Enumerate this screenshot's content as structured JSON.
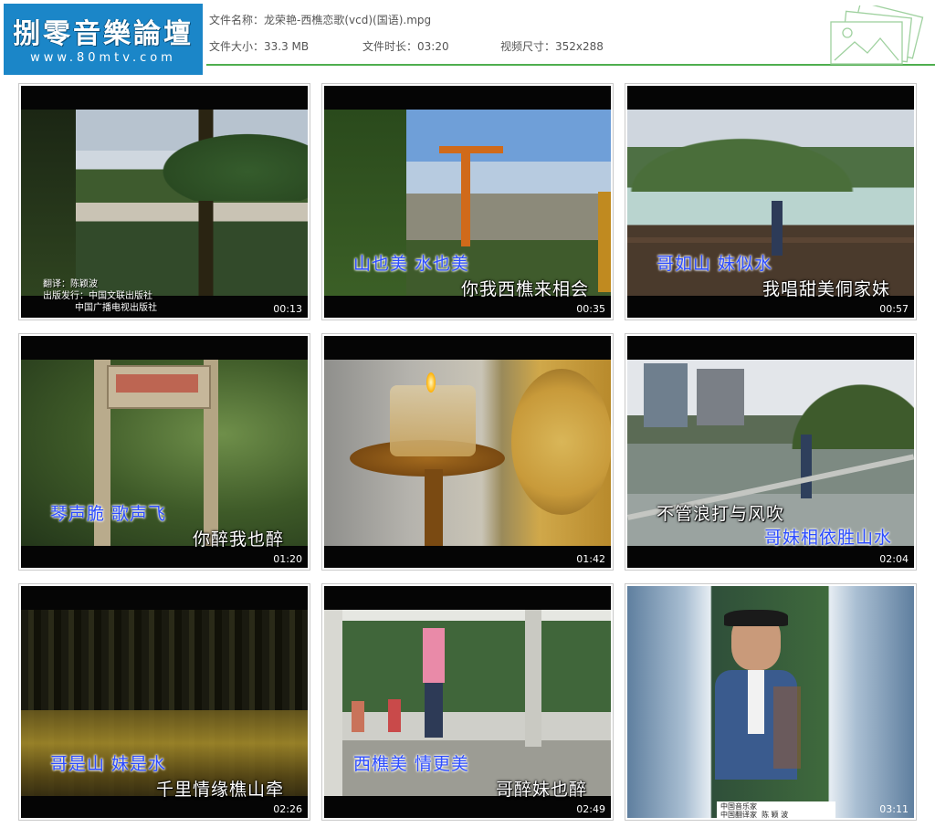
{
  "logo": {
    "title": "捌零音樂論壇",
    "url": "www.80mtv.com"
  },
  "file": {
    "name_label": "文件名称：",
    "name_value": "龙荣艳-西樵恋歌(vcd)(国语).mpg",
    "size_label": "文件大小：",
    "size_value": "33.3 MB",
    "duration_label": "文件时长：",
    "duration_value": "03:20",
    "resolution_label": "视频尺寸：",
    "resolution_value": "352x288"
  },
  "colors": {
    "accent_line": "#4fae4f",
    "logo_bg": "#1b86c8",
    "lyric_blue": "#2c4cff"
  },
  "thumbnails": [
    {
      "time": "00:13",
      "lyric_blue": "",
      "lyric_white": "",
      "credits": "翻译：陈颖波\n出版发行：中国文联出版社\n           中国广播电视出版社"
    },
    {
      "time": "00:35",
      "lyric_blue": "山也美 水也美",
      "lyric_white": "你我西樵来相会"
    },
    {
      "time": "00:57",
      "lyric_blue": "哥如山 妹似水",
      "lyric_white": "我唱甜美侗家妹"
    },
    {
      "time": "01:20",
      "lyric_blue": "琴声脆 歌声飞",
      "lyric_white": "你醉我也醉"
    },
    {
      "time": "01:42",
      "lyric_blue": "",
      "lyric_white": ""
    },
    {
      "time": "02:04",
      "lyric_blue": "哥妹相依胜山水",
      "lyric_white": "不管浪打与风吹"
    },
    {
      "time": "02:26",
      "lyric_blue": "哥是山 妹是水",
      "lyric_white": "千里情缘樵山牵"
    },
    {
      "time": "02:49",
      "lyric_blue": "西樵美 情更美",
      "lyric_white": "哥醉妹也醉"
    },
    {
      "time": "03:11",
      "lyric_blue": "",
      "lyric_white": "",
      "signature": "中国音乐家\n中国翻译家  陈 颖 波"
    }
  ]
}
